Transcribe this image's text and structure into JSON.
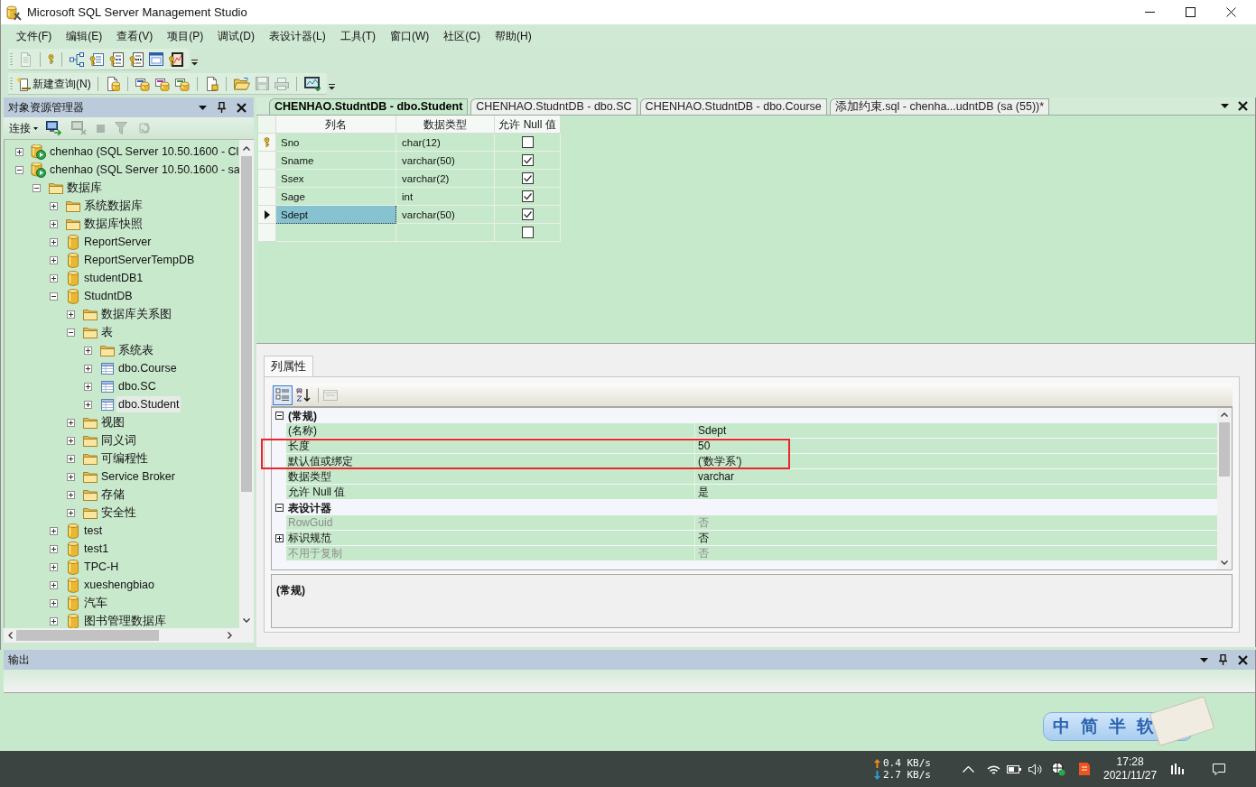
{
  "window": {
    "title": "Microsoft SQL Server Management Studio"
  },
  "menu": [
    "文件(F)",
    "编辑(E)",
    "查看(V)",
    "项目(P)",
    "调试(D)",
    "表设计器(L)",
    "工具(T)",
    "窗口(W)",
    "社区(C)",
    "帮助(H)"
  ],
  "toolbar_1": [
    {
      "disabled": true
    },
    {
      "disabled": false
    },
    {
      "disabled": false
    },
    {
      "disabled": false
    },
    {
      "disabled": false
    },
    {
      "disabled": false
    },
    {
      "disabled": false
    },
    {
      "disabled": false
    }
  ],
  "toolbar_2": {
    "new_query": "新建查询(N)",
    "buttons": [
      {
        "disabled": false
      },
      {
        "disabled": false
      },
      {
        "disabled": false
      },
      {
        "disabled": false
      },
      {
        "disabled": false
      },
      {
        "disabled": false
      },
      {
        "disabled": true
      },
      {
        "disabled": true
      },
      {
        "disabled": false
      }
    ]
  },
  "object_explorer": {
    "title": "对象资源管理器",
    "connect": "连接",
    "buttons": [
      {
        "disabled": false
      },
      {
        "disabled": true
      },
      {
        "disabled": true
      },
      {
        "disabled": true
      },
      {
        "disabled": true
      }
    ],
    "tree": [
      {
        "label": "chenhao (SQL Server 10.50.1600 - Cl",
        "kind": "server",
        "expanded": false,
        "selected": false
      },
      {
        "label": "chenhao (SQL Server 10.50.1600 - sa",
        "kind": "server",
        "expanded": true,
        "selected": false,
        "children": [
          {
            "label": "数据库",
            "kind": "folder",
            "expanded": true,
            "selected": false,
            "children": [
              {
                "label": "系统数据库",
                "kind": "folder",
                "expanded": false,
                "selected": false
              },
              {
                "label": "数据库快照",
                "kind": "folder",
                "expanded": false,
                "selected": false
              },
              {
                "label": "ReportServer",
                "kind": "database",
                "expanded": false,
                "selected": false
              },
              {
                "label": "ReportServerTempDB",
                "kind": "database",
                "expanded": false,
                "selected": false
              },
              {
                "label": "studentDB1",
                "kind": "database",
                "expanded": false,
                "selected": false
              },
              {
                "label": "StudntDB",
                "kind": "database",
                "expanded": true,
                "selected": false,
                "children": [
                  {
                    "label": "数据库关系图",
                    "kind": "folder",
                    "expanded": false,
                    "selected": false
                  },
                  {
                    "label": "表",
                    "kind": "folder",
                    "expanded": true,
                    "selected": false,
                    "children": [
                      {
                        "label": "系统表",
                        "kind": "folder",
                        "expanded": false,
                        "selected": false
                      },
                      {
                        "label": "dbo.Course",
                        "kind": "table",
                        "expanded": false,
                        "selected": false
                      },
                      {
                        "label": "dbo.SC",
                        "kind": "table",
                        "expanded": false,
                        "selected": false
                      },
                      {
                        "label": "dbo.Student",
                        "kind": "table",
                        "expanded": false,
                        "selected": true
                      }
                    ]
                  },
                  {
                    "label": "视图",
                    "kind": "folder",
                    "expanded": false,
                    "selected": false
                  },
                  {
                    "label": "同义词",
                    "kind": "folder",
                    "expanded": false,
                    "selected": false
                  },
                  {
                    "label": "可编程性",
                    "kind": "folder",
                    "expanded": false,
                    "selected": false
                  },
                  {
                    "label": "Service Broker",
                    "kind": "folder",
                    "expanded": false,
                    "selected": false
                  },
                  {
                    "label": "存储",
                    "kind": "folder",
                    "expanded": false,
                    "selected": false
                  },
                  {
                    "label": "安全性",
                    "kind": "folder",
                    "expanded": false,
                    "selected": false
                  }
                ]
              },
              {
                "label": "test",
                "kind": "database",
                "expanded": false,
                "selected": false
              },
              {
                "label": "test1",
                "kind": "database",
                "expanded": false,
                "selected": false
              },
              {
                "label": "TPC-H",
                "kind": "database",
                "expanded": false,
                "selected": false
              },
              {
                "label": "xueshengbiao",
                "kind": "database",
                "expanded": false,
                "selected": false
              },
              {
                "label": "汽车",
                "kind": "database",
                "expanded": false,
                "selected": false
              },
              {
                "label": "图书管理数据库",
                "kind": "database",
                "expanded": false,
                "selected": false
              }
            ]
          }
        ]
      }
    ]
  },
  "document_tabs": [
    {
      "label": "CHENHAO.StudntDB - dbo.Student",
      "selected": true
    },
    {
      "label": "CHENHAO.StudntDB - dbo.SC",
      "selected": false
    },
    {
      "label": "CHENHAO.StudntDB - dbo.Course",
      "selected": false
    },
    {
      "label": "添加约束.sql - chenha...udntDB (sa (55))*",
      "selected": false
    }
  ],
  "table_designer": {
    "headers": [
      "列名",
      "数据类型",
      "允许 Null 值"
    ],
    "rows": [
      {
        "name": "Sno",
        "data_type": "char(12)",
        "allow_null": false,
        "primary_key": true,
        "selected": false
      },
      {
        "name": "Sname",
        "data_type": "varchar(50)",
        "allow_null": true,
        "primary_key": false,
        "selected": false
      },
      {
        "name": "Ssex",
        "data_type": "varchar(2)",
        "allow_null": true,
        "primary_key": false,
        "selected": false
      },
      {
        "name": "Sage",
        "data_type": "int",
        "allow_null": true,
        "primary_key": false,
        "selected": false
      },
      {
        "name": "Sdept",
        "data_type": "varchar(50)",
        "allow_null": true,
        "primary_key": false,
        "selected": true
      }
    ],
    "new_row": {
      "allow_null": false
    }
  },
  "column_properties": {
    "tab": "列属性",
    "toolbar": [
      {
        "selected": true,
        "disabled": false
      },
      {
        "selected": false,
        "disabled": false
      },
      {
        "selected": false,
        "disabled": true
      }
    ],
    "categories": [
      {
        "name": "(常规)",
        "expanded": true,
        "rows": [
          {
            "kind": "property",
            "name": "(名称)",
            "value": "Sdept",
            "disabled": false,
            "highlighted": false
          },
          {
            "kind": "property",
            "name": "长度",
            "value": "50",
            "disabled": false,
            "highlighted": true
          },
          {
            "kind": "property",
            "name": "默认值或绑定",
            "value": "('数学系')",
            "disabled": false,
            "highlighted": true
          },
          {
            "kind": "property",
            "name": "数据类型",
            "value": "varchar",
            "disabled": false,
            "highlighted": false
          },
          {
            "kind": "property",
            "name": "允许 Null 值",
            "value": "是",
            "disabled": false,
            "highlighted": false
          }
        ]
      },
      {
        "name": "表设计器",
        "expanded": true,
        "rows": [
          {
            "kind": "property",
            "name": "RowGuid",
            "value": "否",
            "disabled": true,
            "highlighted": false
          },
          {
            "kind": "group",
            "name": "标识规范",
            "value": "否",
            "expanded": false,
            "disabled": false,
            "highlighted": false
          },
          {
            "kind": "property",
            "name": "不用于复制",
            "value": "否",
            "disabled": true,
            "highlighted": false
          }
        ]
      }
    ],
    "description": "(常规)"
  },
  "output": {
    "title": "输出"
  },
  "ime_bar": [
    "中",
    "简",
    "半",
    "软"
  ],
  "taskbar": {
    "upload": "0.4 KB/s",
    "download": "2.7 KB/s",
    "time": "17:28",
    "date": "2021/11/27"
  }
}
